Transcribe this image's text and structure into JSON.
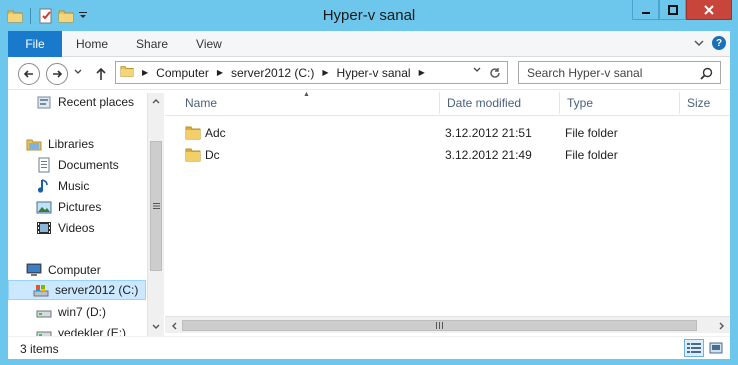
{
  "window": {
    "title": "Hyper-v sanal"
  },
  "ribbon": {
    "file_tab": "File",
    "tabs": [
      "Home",
      "Share",
      "View"
    ]
  },
  "address": {
    "crumbs": [
      "Computer",
      "server2012 (C:)",
      "Hyper-v sanal"
    ],
    "search_placeholder": "Search Hyper-v sanal"
  },
  "nav": {
    "items": [
      {
        "label": "Recent places",
        "icon": "recent-places-icon"
      },
      {
        "label": "Libraries",
        "icon": "libraries-icon"
      },
      {
        "label": "Documents",
        "icon": "documents-icon"
      },
      {
        "label": "Music",
        "icon": "music-icon"
      },
      {
        "label": "Pictures",
        "icon": "pictures-icon"
      },
      {
        "label": "Videos",
        "icon": "videos-icon"
      },
      {
        "label": "Computer",
        "icon": "computer-icon"
      },
      {
        "label": "server2012 (C:)",
        "icon": "drive-icon",
        "selected": true
      },
      {
        "label": "win7 (D:)",
        "icon": "drive-icon"
      },
      {
        "label": "yedekler (E:)",
        "icon": "drive-icon"
      }
    ]
  },
  "columns": {
    "name": "Name",
    "date": "Date modified",
    "type": "Type",
    "size": "Size"
  },
  "files": [
    {
      "name": "Adc",
      "date": "3.12.2012 21:51",
      "type": "File folder"
    },
    {
      "name": "Dc",
      "date": "3.12.2012 21:49",
      "type": "File folder"
    }
  ],
  "status": {
    "count": "3 items"
  },
  "colors": {
    "frame": "#6dc7ec",
    "file_tab": "#1979ca",
    "selection": "#cce8ff",
    "close_button": "#c7453b",
    "folder": "#e8c25b"
  }
}
